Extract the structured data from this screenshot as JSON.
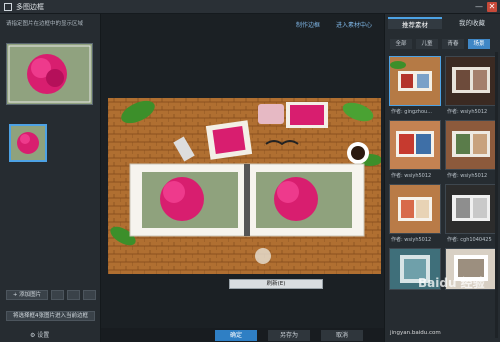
{
  "window": {
    "title": "多图边框",
    "min_label": "—",
    "close_label": "✕"
  },
  "left": {
    "hint": "请指定图片在边框中的显示区域",
    "add_button": "+ 添加图片",
    "small_buttons": [
      "",
      "",
      ""
    ],
    "move_button": "将选择框4张图片进入当前边框",
    "settings": "⚙ 设置"
  },
  "toolbar": {
    "make_frame": "制作边框",
    "enter_center": "进入素材中心"
  },
  "canvas": {
    "refresh_button": "刷新(E)"
  },
  "bottom": {
    "ok": "确定",
    "save_as": "另存为",
    "cancel": "取消"
  },
  "right": {
    "tabs": [
      "推荐素材",
      "我的收藏"
    ],
    "categories": [
      "全部",
      "儿童",
      "青春",
      "场景"
    ],
    "active_category": 3,
    "items": [
      {
        "author": "作者: gingzhou..."
      },
      {
        "author": "作者: wsiyh5012"
      },
      {
        "author": "作者: wsiyh5012"
      },
      {
        "author": "作者: wsiyh5012"
      },
      {
        "author": "作者: wsiyh5012"
      },
      {
        "author": "作者: cgh1040425"
      },
      {
        "author": ""
      },
      {
        "author": ""
      }
    ],
    "watermark": "Baidu 经验",
    "watermark_url": "jingyan.baidu.com"
  },
  "colors": {
    "accent": "#3f87c6",
    "ok_button": "#2f7fc4",
    "close_button": "#c74a3a"
  }
}
